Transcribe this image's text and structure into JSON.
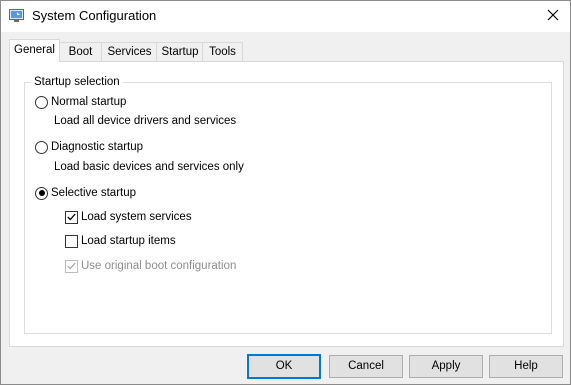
{
  "window": {
    "title": "System Configuration"
  },
  "tabs": [
    {
      "label": "General",
      "active": true
    },
    {
      "label": "Boot",
      "active": false
    },
    {
      "label": "Services",
      "active": false
    },
    {
      "label": "Startup",
      "active": false
    },
    {
      "label": "Tools",
      "active": false
    }
  ],
  "startup_selection": {
    "group_title": "Startup selection",
    "normal": {
      "label": "Normal startup",
      "description": "Load all device drivers and services",
      "selected": false
    },
    "diagnostic": {
      "label": "Diagnostic startup",
      "description": "Load basic devices and services only",
      "selected": false
    },
    "selective": {
      "label": "Selective startup",
      "selected": true,
      "options": [
        {
          "label": "Load system services",
          "checked": true,
          "enabled": true
        },
        {
          "label": "Load startup items",
          "checked": false,
          "enabled": true
        },
        {
          "label": "Use original boot configuration",
          "checked": true,
          "enabled": false
        }
      ]
    }
  },
  "buttons": {
    "ok": "OK",
    "cancel": "Cancel",
    "apply": "Apply",
    "help": "Help"
  },
  "colors": {
    "focus_border": "#0078d7",
    "disabled_text": "#8d8d8d"
  },
  "icons": {
    "app": "system-config-icon",
    "close": "close-icon"
  }
}
